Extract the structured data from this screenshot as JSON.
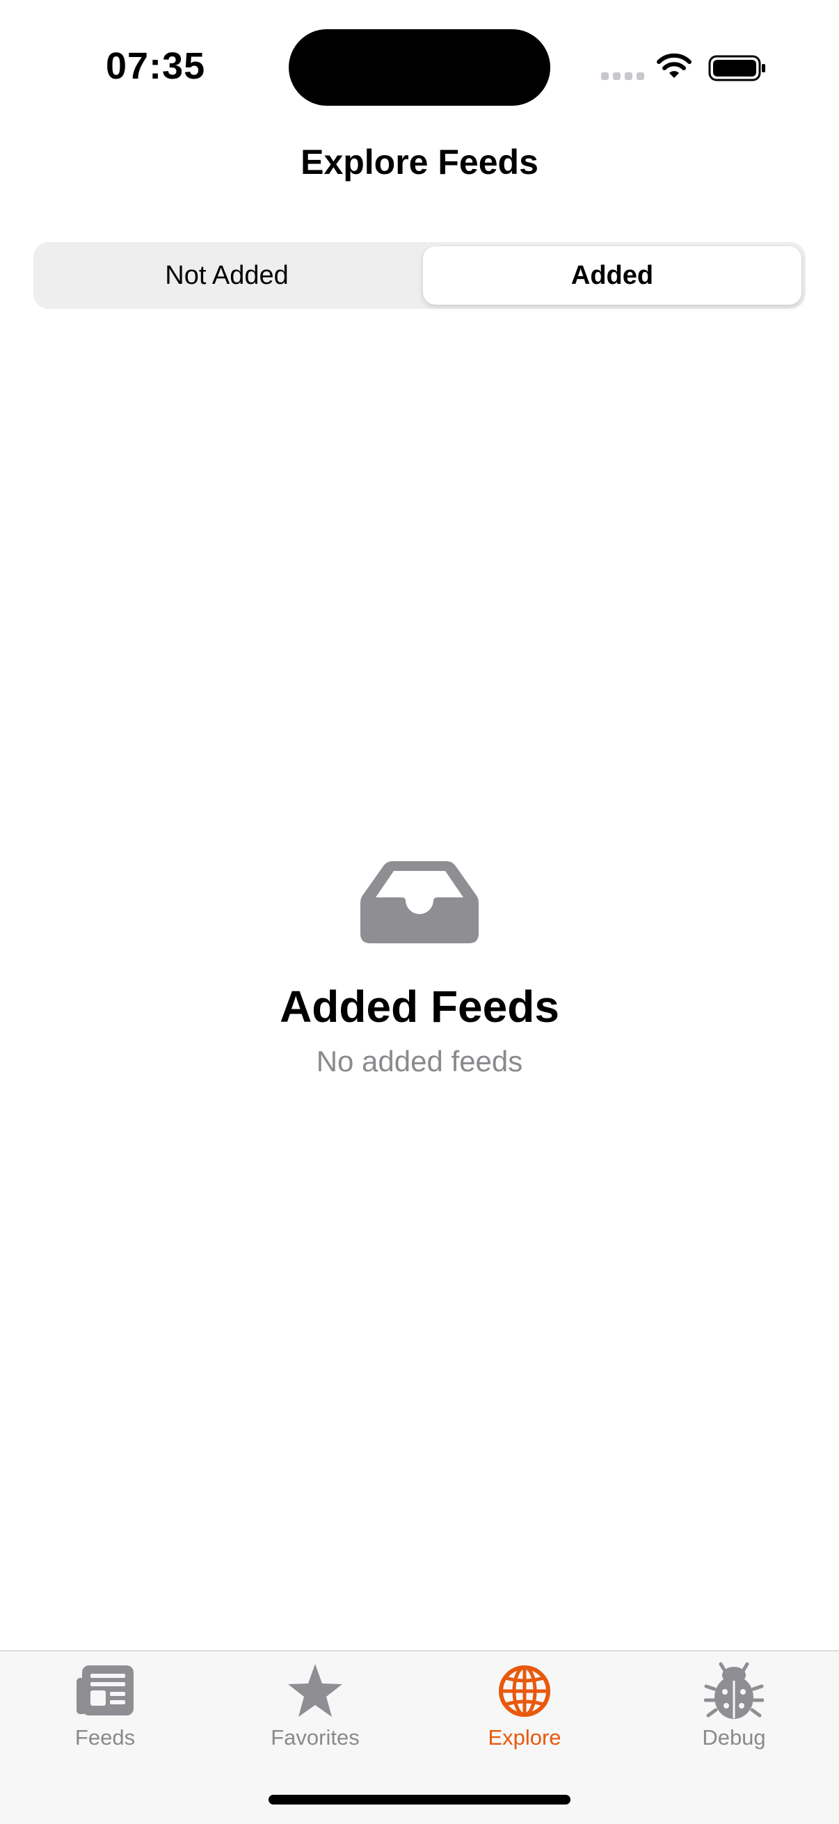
{
  "status_bar": {
    "time": "07:35"
  },
  "nav": {
    "title": "Explore Feeds"
  },
  "segments": {
    "not_added": "Not Added",
    "added": "Added",
    "selected": "Added"
  },
  "empty_state": {
    "icon": "tray-icon",
    "title": "Added Feeds",
    "subtitle": "No added feeds"
  },
  "tabs": [
    {
      "label": "Feeds",
      "icon": "newspaper-icon",
      "active": false
    },
    {
      "label": "Favorites",
      "icon": "star-icon",
      "active": false
    },
    {
      "label": "Explore",
      "icon": "globe-icon",
      "active": true
    },
    {
      "label": "Debug",
      "icon": "ladybug-icon",
      "active": false
    }
  ],
  "colors": {
    "accent": "#e8590c",
    "inactive": "#8a8a8e",
    "icon_gray": "#8e8e93",
    "tab_bar_bg": "#f7f7f7"
  }
}
